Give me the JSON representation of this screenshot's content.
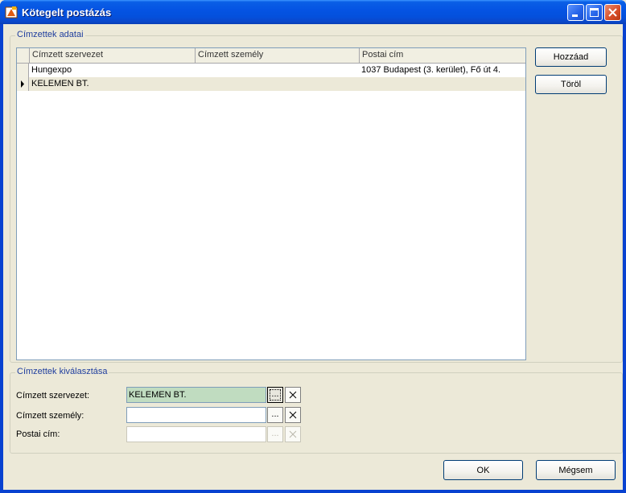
{
  "window": {
    "title": "Kötegelt postázás"
  },
  "recipients_group": {
    "label": "Címzettek adatai",
    "columns": [
      "Címzett szervezet",
      "Címzett személy",
      "Postai cím"
    ],
    "rows": [
      {
        "organization": "Hungexpo",
        "person": "",
        "address": "1037 Budapest (3. kerület), Fő út 4."
      },
      {
        "organization": "KELEMEN BT.",
        "person": "",
        "address": ""
      }
    ],
    "add_label": "Hozzáad",
    "delete_label": "Töröl"
  },
  "selection_group": {
    "label": "Címzettek kiválasztása",
    "organization_label": "Címzett szervezet:",
    "organization_value": "KELEMEN BT.",
    "person_label": "Címzett személy:",
    "person_value": "",
    "address_label": "Postai cím:",
    "address_value": "",
    "browse_glyph": "...",
    "clear_glyph": "X"
  },
  "footer": {
    "ok_label": "OK",
    "cancel_label": "Mégsem"
  }
}
